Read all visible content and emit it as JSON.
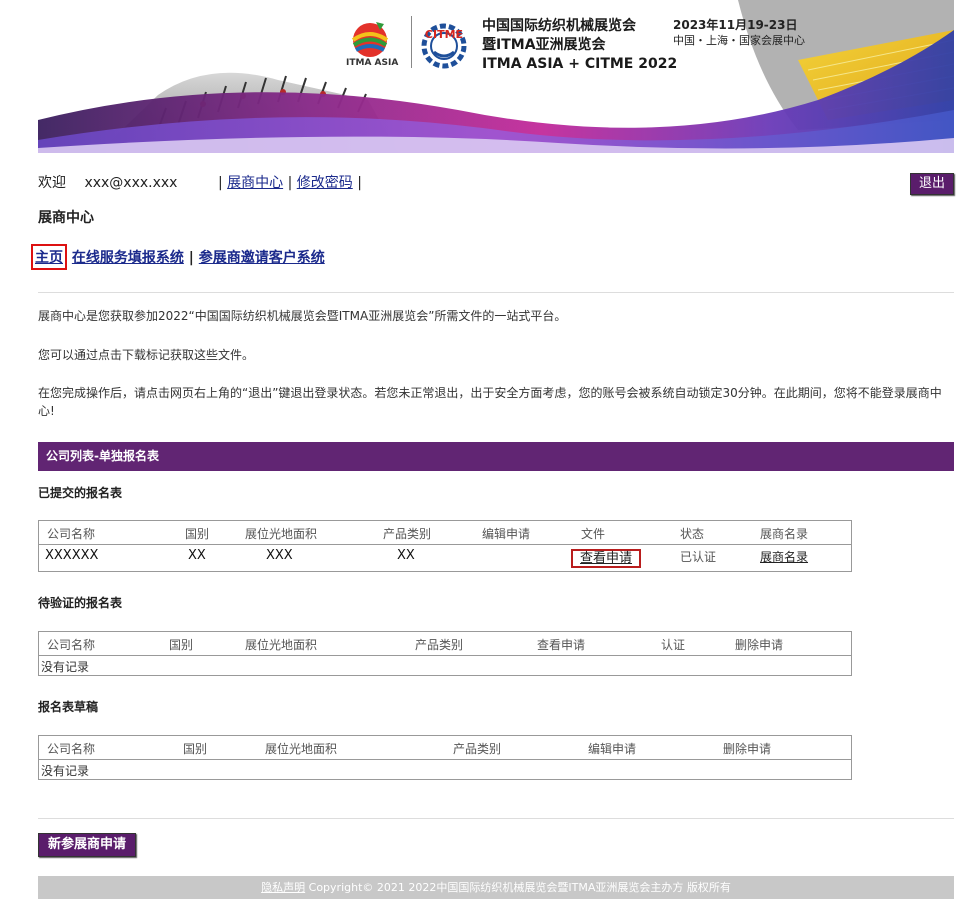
{
  "banner": {
    "itma_label": "ITMA ASIA",
    "citme_label": "CITME",
    "title_line1": "中国国际纺织机械展览会",
    "title_line2": "暨ITMA亚洲展览会",
    "title_line3": "ITMA ASIA + CITME 2022",
    "date": "2023年11月19-23日",
    "location": "中国・上海・国家会展中心"
  },
  "header": {
    "welcome": "欢迎",
    "email": "xxx@xxx.xxx",
    "sep1": "|",
    "link_exhibitor": "展商中心",
    "sep2": "|",
    "link_password": "修改密码",
    "sep3": "|",
    "logout": "退出"
  },
  "section_title": "展商中心",
  "nav": {
    "home": "主页",
    "online_service": "在线服务填报系统",
    "sep": "|",
    "invite": "参展商邀请客户系统"
  },
  "intro": {
    "p1": "展商中心是您获取参加2022“中国国际纺织机械展览会暨ITMA亚洲展览会”所需文件的一站式平台。",
    "p2": "您可以通过点击下载标记获取这些文件。",
    "p3": "在您完成操作后，请点击网页右上角的“退出”键退出登录状态。若您未正常退出，出于安全方面考虑，您的账号会被系统自动锁定30分钟。在此期间，您将不能登录展商中心!"
  },
  "company_list_bar": "公司列表-单独报名表",
  "submitted": {
    "heading": "已提交的报名表",
    "columns": [
      "公司名称",
      "国别",
      "展位光地面积",
      "产品类别",
      "编辑申请",
      "文件",
      "状态",
      "展商名录"
    ],
    "row": {
      "company": "XXXXXX",
      "country": "XX",
      "area": "XXX",
      "category": "XX",
      "file_link": "查看申请",
      "status": "已认证",
      "directory_link": "展商名录"
    }
  },
  "pending": {
    "heading": "待验证的报名表",
    "columns": [
      "公司名称",
      "国别",
      "展位光地面积",
      "产品类别",
      "查看申请",
      "认证",
      "删除申请"
    ],
    "empty": "没有记录"
  },
  "drafts": {
    "heading": "报名表草稿",
    "columns": [
      "公司名称",
      "国别",
      "展位光地面积",
      "产品类别",
      "编辑申请",
      "删除申请"
    ],
    "empty": "没有记录"
  },
  "new_application_button": "新参展商申请",
  "footer": {
    "privacy_link": "隐私声明",
    "copyright": " Copyright© 2021 2022中国国际纺织机械展览会暨ITMA亚洲展览会主办方 版权所有"
  },
  "colors": {
    "purple": "#612573",
    "link_blue": "#1b2a8c",
    "highlight_red": "#d11111"
  }
}
